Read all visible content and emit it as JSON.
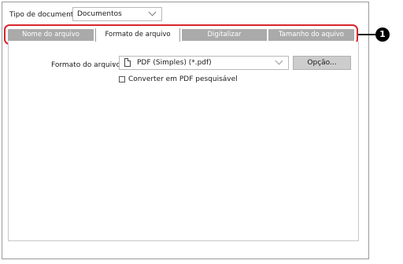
{
  "doc_type": {
    "label": "Tipo de documento:",
    "value": "Documentos"
  },
  "tabs": [
    {
      "label": "Nome do arquivo",
      "selected": false
    },
    {
      "label": "Formato de arquivo",
      "selected": true
    },
    {
      "label": "Digitalizar",
      "selected": false
    },
    {
      "label": "Tamanho do aquivo",
      "selected": false
    }
  ],
  "callout": {
    "number": "1",
    "color": "#d8262c"
  },
  "format": {
    "label": "Formato do arquivo",
    "colon": ":",
    "value": "PDF (Simples) (*.pdf)",
    "option_button": "Opção..."
  },
  "convert_checkbox": {
    "label": "Converter em PDF pesquisável",
    "checked": false
  },
  "colors": {
    "tab_inactive": "#aaaaaa",
    "tab_text": "#ffffff",
    "button_bg": "#cdcdcd"
  }
}
